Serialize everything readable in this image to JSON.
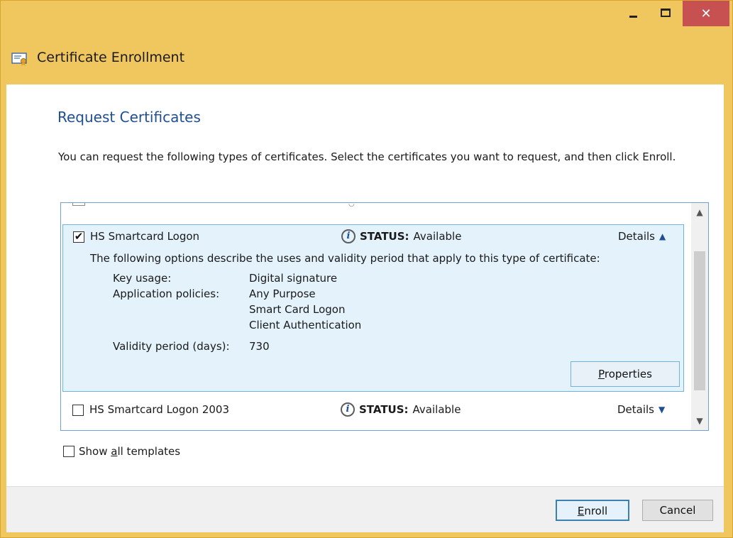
{
  "window": {
    "title": "Certificate Enrollment",
    "controls": {
      "minimize_icon": "minimize-icon",
      "maximize_icon": "maximize-icon",
      "close_label": "✕"
    }
  },
  "page": {
    "title": "Request Certificates",
    "instructions": "You can request the following types of certificates. Select the certificates you want to request, and then click Enroll."
  },
  "certificates": [
    {
      "name": "HS Smartcard Logon",
      "checked": true,
      "status_label": "STATUS:",
      "status_value": "Available",
      "details_label": "Details",
      "expanded": true,
      "description": "The following options describe the uses and validity period that apply to this type of certificate:",
      "key_usage_label": "Key usage:",
      "key_usage_value": "Digital signature",
      "app_policies_label": "Application policies:",
      "app_policies": [
        "Any Purpose",
        "Smart Card Logon",
        "Client Authentication"
      ],
      "validity_label": "Validity period (days):",
      "validity_value": "730",
      "properties_button": {
        "prefix": "",
        "underlined": "P",
        "rest": "roperties"
      }
    },
    {
      "name": "HS Smartcard Logon 2003",
      "checked": false,
      "status_label": "STATUS:",
      "status_value": "Available",
      "details_label": "Details",
      "expanded": false
    }
  ],
  "show_all": {
    "prefix": "Show ",
    "underlined": "a",
    "rest": "ll templates",
    "checked": false
  },
  "footer": {
    "enroll": {
      "underlined": "E",
      "rest": "nroll"
    },
    "cancel": "Cancel"
  },
  "colors": {
    "frame": "#f0c75e",
    "accent": "#1e4f96",
    "close": "#c75050",
    "selected_bg": "#e3f2fb"
  }
}
